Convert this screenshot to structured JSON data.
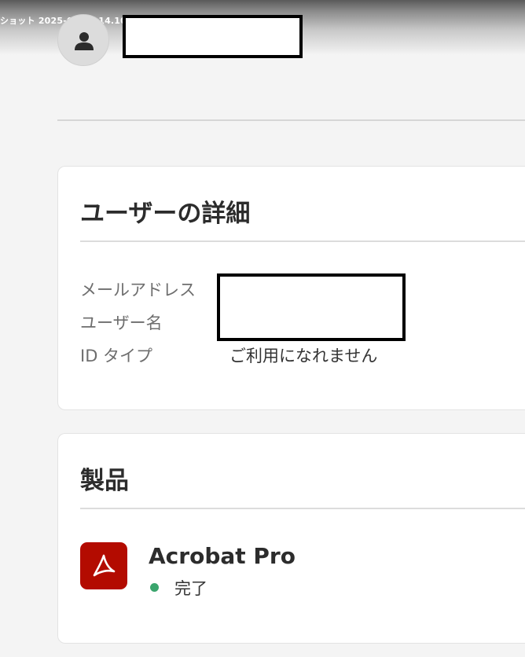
{
  "screenshot_label": "ショット 2025-05-16 14.10.1",
  "user_details": {
    "title": "ユーザーの詳細",
    "fields": [
      {
        "label": "メールアドレス",
        "value": ""
      },
      {
        "label": "ユーザー名",
        "value": ""
      },
      {
        "label": "ID タイプ",
        "value": "ご利用になれません"
      }
    ]
  },
  "products": {
    "title": "製品",
    "items": [
      {
        "name": "Acrobat Pro",
        "status": "完了",
        "status_color": "#3aa56d",
        "icon": "acrobat-icon",
        "icon_color": "#b30b00"
      }
    ]
  },
  "colors": {
    "background": "#f4f4f4",
    "card": "#ffffff",
    "label_gray": "#6e6e6e"
  }
}
